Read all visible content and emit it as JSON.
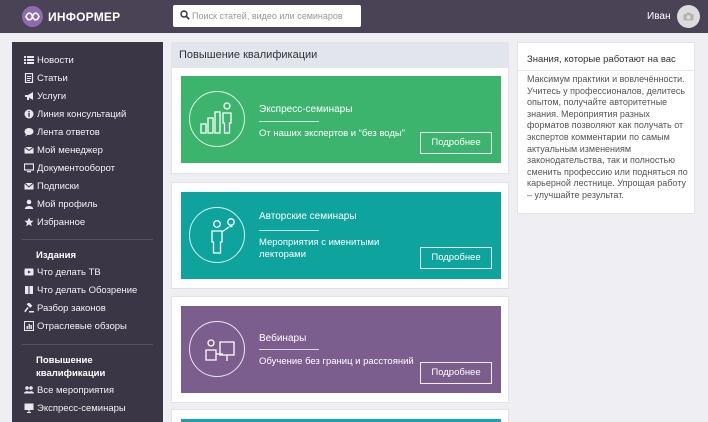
{
  "header": {
    "brand": "ИНФОРМЕР",
    "search_placeholder": "Поиск статей, видео или семинаров",
    "user_name": "Иван"
  },
  "sidebar": {
    "main_items": [
      {
        "label": "Новости",
        "icon": "list-icon"
      },
      {
        "label": "Статьи",
        "icon": "document-icon"
      },
      {
        "label": "Услуги",
        "icon": "megaphone-icon"
      },
      {
        "label": "Линия консультаций",
        "icon": "info-icon"
      },
      {
        "label": "Лента ответов",
        "icon": "chat-icon"
      },
      {
        "label": "Мой менеджер",
        "icon": "mail-icon"
      },
      {
        "label": "Документооборот",
        "icon": "monitor-icon"
      },
      {
        "label": "Подписки",
        "icon": "envelope-icon"
      },
      {
        "label": "Мой профиль",
        "icon": "user-icon"
      },
      {
        "label": "Избранное",
        "icon": "star-icon"
      }
    ],
    "publications_title": "Издания",
    "publications": [
      {
        "label": "Что делать ТВ",
        "icon": "video-icon"
      },
      {
        "label": "Что делать Обозрение",
        "icon": "book-icon"
      },
      {
        "label": "Разбор законов",
        "icon": "gavel-icon"
      },
      {
        "label": "Отраслевые обзоры",
        "icon": "chart-icon"
      }
    ],
    "training_title_line1": "Повышение",
    "training_title_line2": "квалификации",
    "training": [
      {
        "label": "Все мероприятия",
        "icon": "group-icon"
      },
      {
        "label": "Экспресс-семинары",
        "icon": "presentation-icon"
      }
    ]
  },
  "main": {
    "title": "Повышение квалификации",
    "cards": [
      {
        "title": "Экспресс-семинары",
        "subtitle": "От наших экспертов и “без воды”",
        "button": "Подробнее",
        "color": "#3cb46e",
        "icon": "bar-chart-person-icon"
      },
      {
        "title": "Авторские семинары",
        "subtitle": "Мероприятия с именитыми лекторами",
        "button": "Подробнее",
        "color": "#0ea39c",
        "icon": "lecturer-idea-icon"
      },
      {
        "title": "Вебинары",
        "subtitle": "Обучение без границ и расстояний",
        "button": "Подробнее",
        "color": "#7b5e8d",
        "icon": "webinar-icon"
      }
    ]
  },
  "aside": {
    "title": "Знания, которые работают на вас",
    "text": "Максимум практики и вовлечённости. Учитесь у профессионалов, делитесь опытом, получайте авторитетные знания. Мероприятия разных форматов позволяют как получать от экспертов комментарии по самым актуальным изменениям законодательства, так и полностью сменить профессию или подняться по карьерной лестнице. Упрощая работу – улучшайте результат."
  },
  "colors": {
    "topbar": "#4a4356",
    "sidebar": "#3b3645",
    "green": "#3cb46e",
    "teal": "#0ea39c",
    "purple": "#7b5e8d",
    "teal_strip": "#1aa0b8"
  }
}
